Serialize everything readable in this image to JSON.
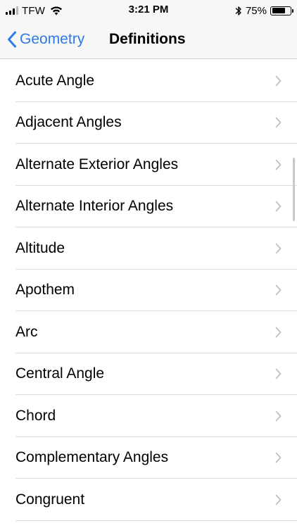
{
  "status_bar": {
    "carrier": "TFW",
    "time": "3:21 PM",
    "battery_percent": "75%",
    "battery_level": 0.75,
    "icons": [
      "signal-icon",
      "wifi-icon",
      "bluetooth-icon",
      "battery-icon"
    ]
  },
  "nav": {
    "back_label": "Geometry",
    "title": "Definitions"
  },
  "colors": {
    "accent": "#2f7ae5",
    "separator": "#dcdcdc",
    "chevron": "#c4c4c7"
  },
  "list": {
    "items": [
      {
        "label": "Acute Angle"
      },
      {
        "label": "Adjacent Angles"
      },
      {
        "label": "Alternate Exterior Angles"
      },
      {
        "label": "Alternate Interior Angles"
      },
      {
        "label": "Altitude"
      },
      {
        "label": "Apothem"
      },
      {
        "label": "Arc"
      },
      {
        "label": "Central Angle"
      },
      {
        "label": "Chord"
      },
      {
        "label": "Complementary Angles"
      },
      {
        "label": "Congruent"
      }
    ]
  }
}
